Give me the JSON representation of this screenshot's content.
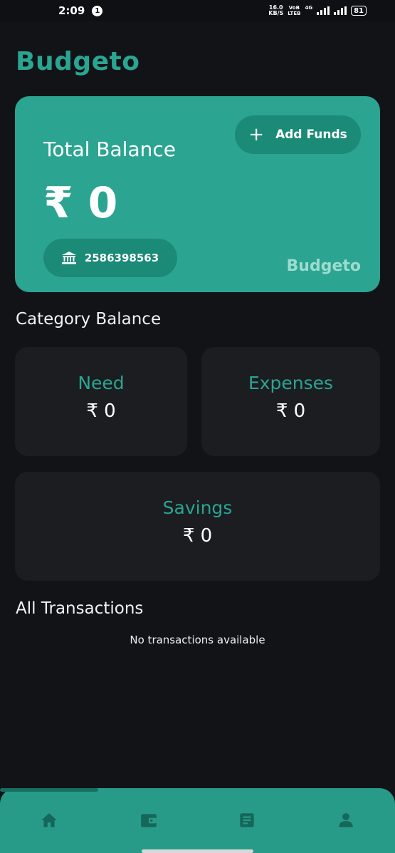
{
  "status_bar": {
    "time": "2:09",
    "notification_count": "1",
    "speed_value": "16.0",
    "speed_unit": "KB/S",
    "volte_top": "VoB",
    "volte_bottom": "LTEB",
    "network": "4G",
    "battery": "81"
  },
  "app": {
    "title": "Budgeto"
  },
  "balance_card": {
    "add_funds_label": "Add Funds",
    "add_funds_icon": "plus-icon",
    "total_label": "Total Balance",
    "total_amount": "₹ 0",
    "account_icon": "bank-icon",
    "account_number": "2586398563",
    "brand": "Budgeto"
  },
  "categories": {
    "title": "Category Balance",
    "items": [
      {
        "name": "Need",
        "amount": "₹ 0"
      },
      {
        "name": "Expenses",
        "amount": "₹ 0"
      },
      {
        "name": "Savings",
        "amount": "₹ 0"
      }
    ]
  },
  "transactions": {
    "title": "All Transactions",
    "empty_message": "No transactions available"
  },
  "bottom_nav": {
    "items": [
      {
        "icon": "home-icon",
        "active": true
      },
      {
        "icon": "wallet-icon",
        "active": false
      },
      {
        "icon": "document-icon",
        "active": false
      },
      {
        "icon": "profile-icon",
        "active": false
      }
    ],
    "icon_color": "#15675a"
  },
  "colors": {
    "accent": "#2aa591",
    "card": "#2ba492",
    "pill": "#1b8a76",
    "background": "#121317",
    "surface": "#1b1d21"
  }
}
